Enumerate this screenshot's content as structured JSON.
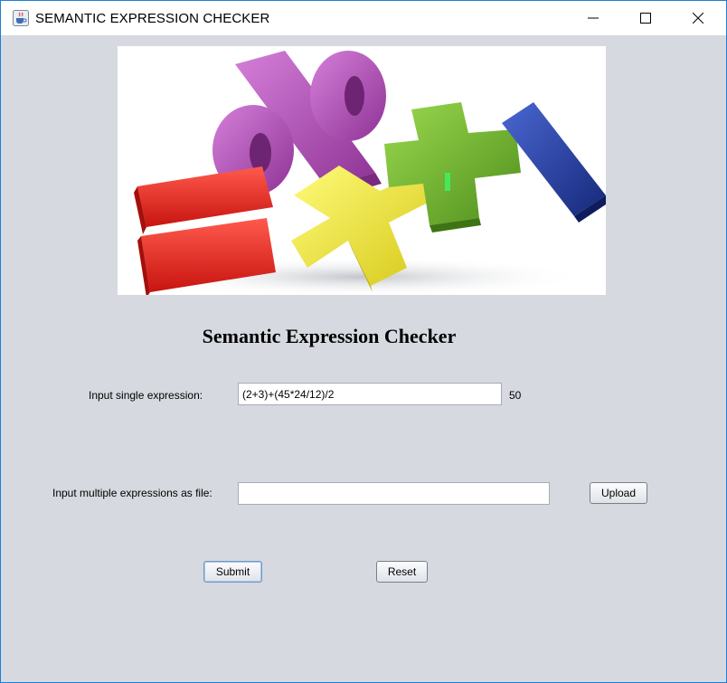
{
  "window": {
    "title": "SEMANTIC EXPRESSION CHECKER",
    "icon": "java-cup-icon",
    "controls": [
      "minimize-icon",
      "maximize-icon",
      "close-icon"
    ]
  },
  "banner": {
    "description_icons": [
      "percent",
      "equals",
      "multiply",
      "plus",
      "minus"
    ],
    "colors": {
      "percent": "#b24fb8",
      "equals": "#e8221e",
      "multiply": "#f2ea2a",
      "plus": "#6db22d",
      "minus": "#1f3a9e"
    }
  },
  "main": {
    "heading": "Semantic Expression Checker",
    "single": {
      "label": "Input single expression:",
      "value": "(2+3)+(45*24/12)/2",
      "result": "50"
    },
    "multiple": {
      "label": "Input multiple expressions as file:",
      "value": "",
      "upload_label": "Upload"
    },
    "actions": {
      "submit_label": "Submit",
      "reset_label": "Reset"
    }
  }
}
